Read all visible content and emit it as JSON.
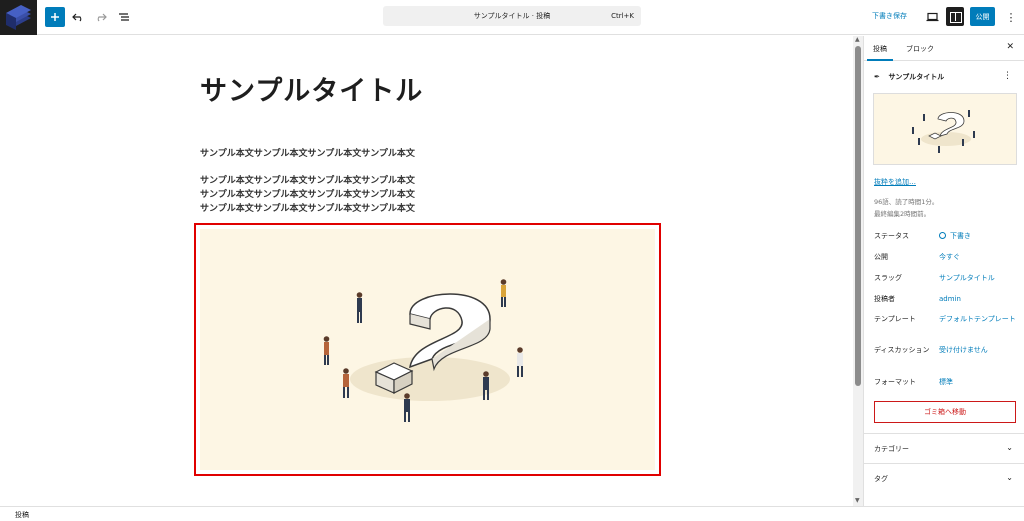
{
  "toolbar": {
    "command_title": "サンプルタイトル · 投稿",
    "command_shortcut": "Ctrl+K",
    "save_draft": "下書き保存",
    "publish": "公開"
  },
  "post": {
    "title": "サンプルタイトル",
    "paragraph1": "サンプル本文サンプル本文サンプル本文サンプル本文",
    "paragraph2_lines": [
      "サンプル本文サンプル本文サンプル本文サンプル本文",
      "サンプル本文サンプル本文サンプル本文サンプル本文",
      "サンプル本文サンプル本文サンプル本文サンプル本文"
    ]
  },
  "sidebar": {
    "tab_post": "投稿",
    "tab_block": "ブロック",
    "post_name": "サンプルタイトル",
    "add_excerpt": "抜粋を追加…",
    "stats": "96語、読了時間1分。",
    "last_edited": "最終編集2時間前。",
    "props": [
      {
        "label": "ステータス",
        "value": "下書き"
      },
      {
        "label": "公開",
        "value": "今すぐ"
      },
      {
        "label": "スラッグ",
        "value": "サンプルタイトル"
      },
      {
        "label": "投稿者",
        "value": "admin"
      },
      {
        "label": "テンプレート",
        "value": "デフォルトテンプレート"
      },
      {
        "label": "ディスカッション",
        "value": "受け付けません"
      },
      {
        "label": "フォーマット",
        "value": "標準"
      }
    ],
    "trash": "ゴミ箱へ移動",
    "categories": "カテゴリー",
    "tags": "タグ"
  },
  "footer": {
    "breadcrumb": "投稿"
  }
}
